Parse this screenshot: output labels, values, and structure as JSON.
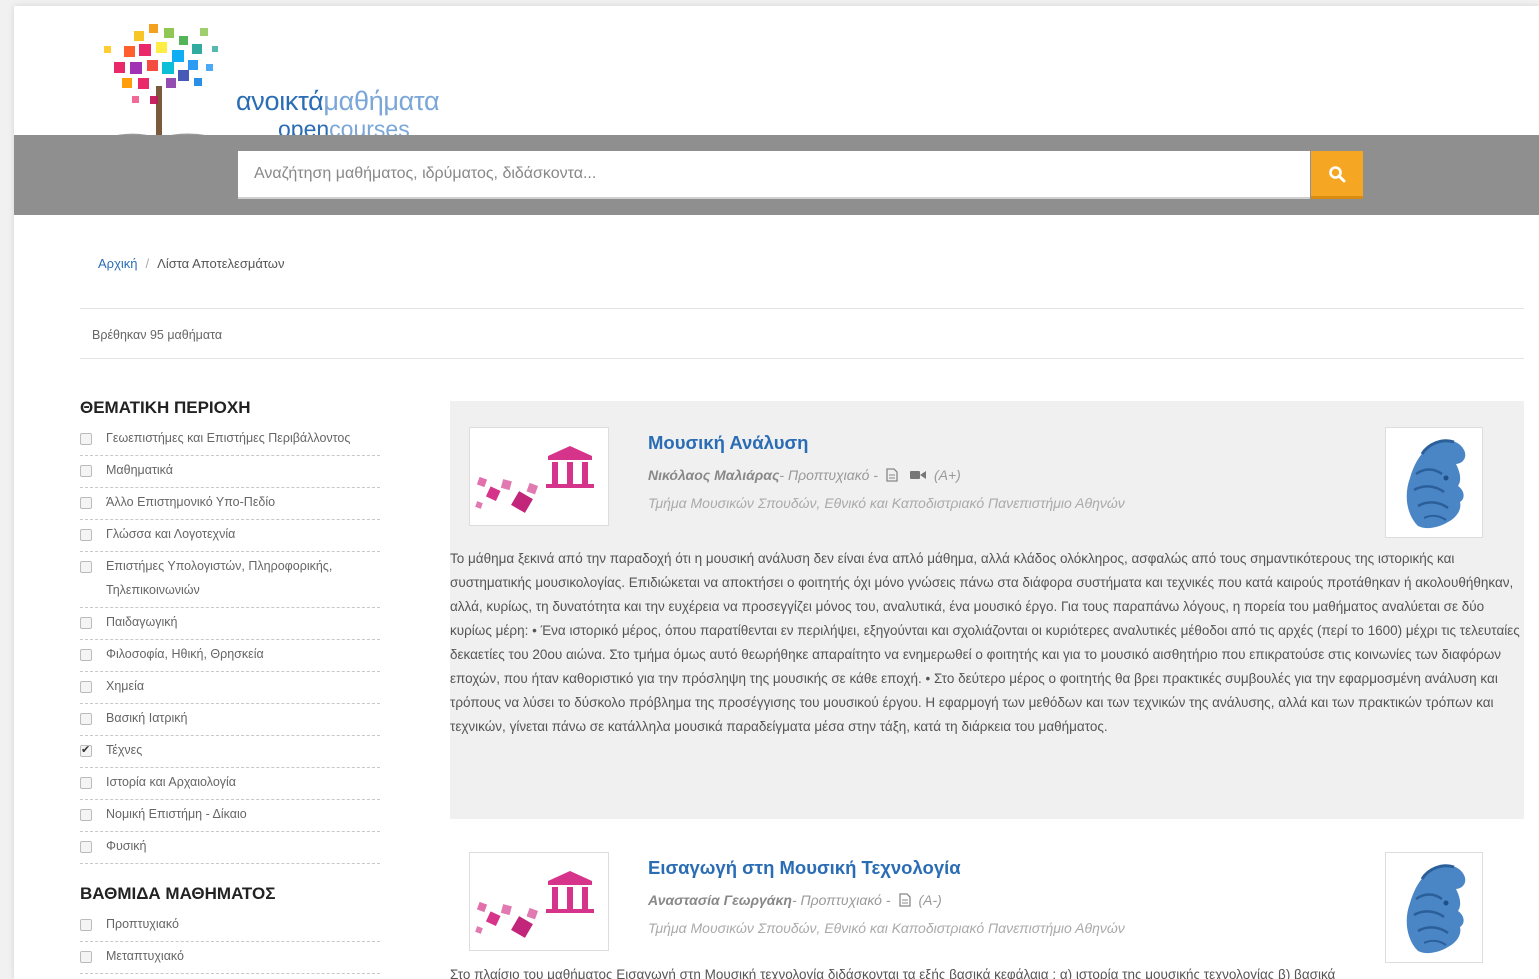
{
  "logo": {
    "greek_a": "ανοικτά",
    "greek_b": "μαθήματα",
    "open": "open",
    "courses": "courses"
  },
  "search": {
    "placeholder": "Αναζήτηση μαθήματος, ιδρύματος, διδάσκοντα..."
  },
  "breadcrumb": {
    "home": "Αρχική",
    "separator": "/",
    "current": "Λίστα Αποτελεσμάτων"
  },
  "results_count": "Βρέθηκαν 95 μαθήματα",
  "sidebar": {
    "subject_title": "ΘΕΜΑΤΙΚΗ ΠΕΡΙΟΧΗ",
    "subjects": [
      {
        "label": "Γεωεπιστήμες και Επιστήμες Περιβάλλοντος",
        "checked": false
      },
      {
        "label": "Μαθηματικά",
        "checked": false
      },
      {
        "label": "Άλλο Επιστημονικό Υπο-Πεδίο",
        "checked": false
      },
      {
        "label": "Γλώσσα και Λογοτεχνία",
        "checked": false
      },
      {
        "label": "Επιστήμες Υπολογιστών, Πληροφορικής, Τηλεπικοινωνιών",
        "checked": false
      },
      {
        "label": "Παιδαγωγική",
        "checked": false
      },
      {
        "label": "Φιλοσοφία, Ηθική, Θρησκεία",
        "checked": false
      },
      {
        "label": "Χημεία",
        "checked": false
      },
      {
        "label": "Βασική Ιατρική",
        "checked": false
      },
      {
        "label": "Τέχνες",
        "checked": true
      },
      {
        "label": "Ιστορία και Αρχαιολογία",
        "checked": false
      },
      {
        "label": "Νομική Επιστήμη - Δίκαιο",
        "checked": false
      },
      {
        "label": "Φυσική",
        "checked": false
      }
    ],
    "level_title": "ΒΑΘΜΙΔΑ ΜΑΘΗΜΑΤΟΣ",
    "levels": [
      {
        "label": "Προπτυχιακό",
        "checked": false
      },
      {
        "label": "Μεταπτυχιακό",
        "checked": false
      }
    ]
  },
  "results": [
    {
      "title": "Μουσική Ανάλυση",
      "professor": "Νικόλαος Μαλιάρας",
      "type": " - Προπτυχιακό - ",
      "level": "(A+)",
      "department": "Τμήμα Μουσικών Σπουδών, Εθνικό και Καποδιστριακό Πανεπιστήμιο Αθηνών",
      "description": "Το μάθημα ξεκινά από την παραδοχή ότι η μουσική ανάλυση δεν είναι ένα απλό μάθημα, αλλά κλάδος ολόκληρος, ασφαλώς από τους σημαντικότερους της ιστορικής και συστηματικής μουσικολογίας. Επιδιώκεται να αποκτήσει ο φοιτητής όχι μόνο γνώσεις πάνω στα διάφορα συστήματα και τεχνικές που κατά καιρούς προτάθηκαν ή ακολουθήθηκαν, αλλά, κυρίως, τη δυνατότητα και την ευχέρεια να προσεγγίζει μόνος του, αναλυτικά, ένα μουσικό έργο. Για τους παραπάνω λόγους, η πορεία του μαθήματος αναλύεται σε δύο κυρίως μέρη: • Ένα ιστορικό μέρος, όπου παρατίθενται εν περιλήψει, εξηγούνται και σχολιάζονται οι κυριότερες αναλυτικές μέθοδοι από τις αρχές (περί το 1600) μέχρι τις τελευταίες δεκαετίες του 20ου αιώνα. Στο τμήμα όμως αυτό θεωρήθηκε απαραίτητο να ενημερωθεί ο φοιτητής και για το μουσικό αισθητήριο που επικρατούσε στις κοινωνίες των διαφόρων εποχών, που ήταν καθοριστικό για την πρόσληψη της μουσικής σε κάθε εποχή. • Στο δεύτερο μέρος ο φοιτητής θα βρει πρακτικές συμβουλές για την εφαρμοσμένη ανάλυση και τρόπους να λύσει το δύσκολο πρόβλημα της προσέγγισης του μουσικού έργου. Η εφαρμογή των μεθόδων και των τεχνικών της ανάλυσης, αλλά και των πρακτικών τρόπων και τεχνικών, γίνεται πάνω σε κατάλληλα μουσικά παραδείγματα μέσα στην τάξη, κατά τη διάρκεια του μαθήματος."
    },
    {
      "title": "Εισαγωγή στη Μουσική Τεχνολογία",
      "professor": "Αναστασία Γεωργάκη",
      "type": " - Προπτυχιακό - ",
      "level": "(A-)",
      "department": "Τμήμα Μουσικών Σπουδών, Εθνικό και Καποδιστριακό Πανεπιστήμιο Αθηνών",
      "description": "Στο πλαίσιο του μαθήματος Εισαγωγή στη Μουσική τεχνολογία διδάσκονται τα εξής βασικά κεφάλαια : α) ιστορία της μουσικής τεχνολογίας β) βασικά"
    }
  ],
  "colors": {
    "brand_blue": "#2a6db5",
    "search_bar": "#8f8f8f",
    "search_button": "#f5a623",
    "result_bg": "#f0f0f0",
    "thumb_pink": "#d6338a"
  },
  "icons": [
    "search-icon",
    "document-icon",
    "video-icon",
    "institution-icon",
    "athena-crest-icon"
  ]
}
